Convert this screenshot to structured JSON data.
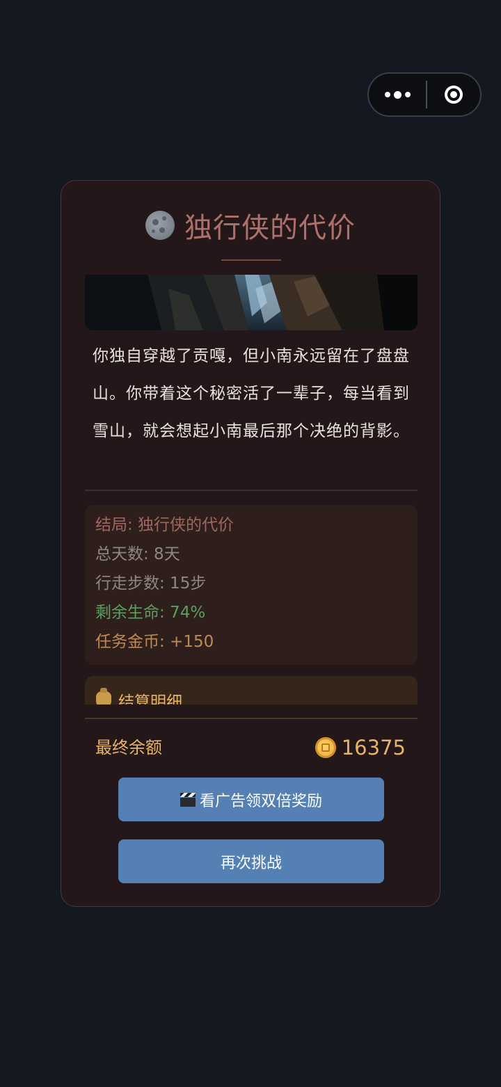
{
  "capsule": {
    "more_icon": "more-dots-icon",
    "close_icon": "target-close-icon"
  },
  "result": {
    "title_icon": "moon-icon",
    "title": "独行侠的代价",
    "story": "你独自穿越了贡嘎，但小南永远留在了盘盘山。你带着这个秘密活了一辈子，每当看到雪山，就会想起小南最后那个决绝的背影。",
    "stats": {
      "ending": "结局: 独行侠的代价",
      "days": "总天数: 8天",
      "steps": "行走步数: 15步",
      "health": "剩余生命: 74%",
      "coins": "任务金币: +150"
    },
    "settlement_title": "结算明细",
    "settlement_icon": "money-bag-icon",
    "final_label": "最终余额",
    "final_icon": "coin-icon",
    "final_amount": "16375",
    "ad_button": "看广告领双倍奖励",
    "ad_icon": "clapper-board-icon",
    "retry_button": "再次挑战"
  },
  "colors": {
    "page_bg": "#141821",
    "card_bg": "#24171a",
    "title": "#b0706a",
    "gold": "#e6b367",
    "green": "#5aa05d",
    "button": "#5480b4"
  }
}
